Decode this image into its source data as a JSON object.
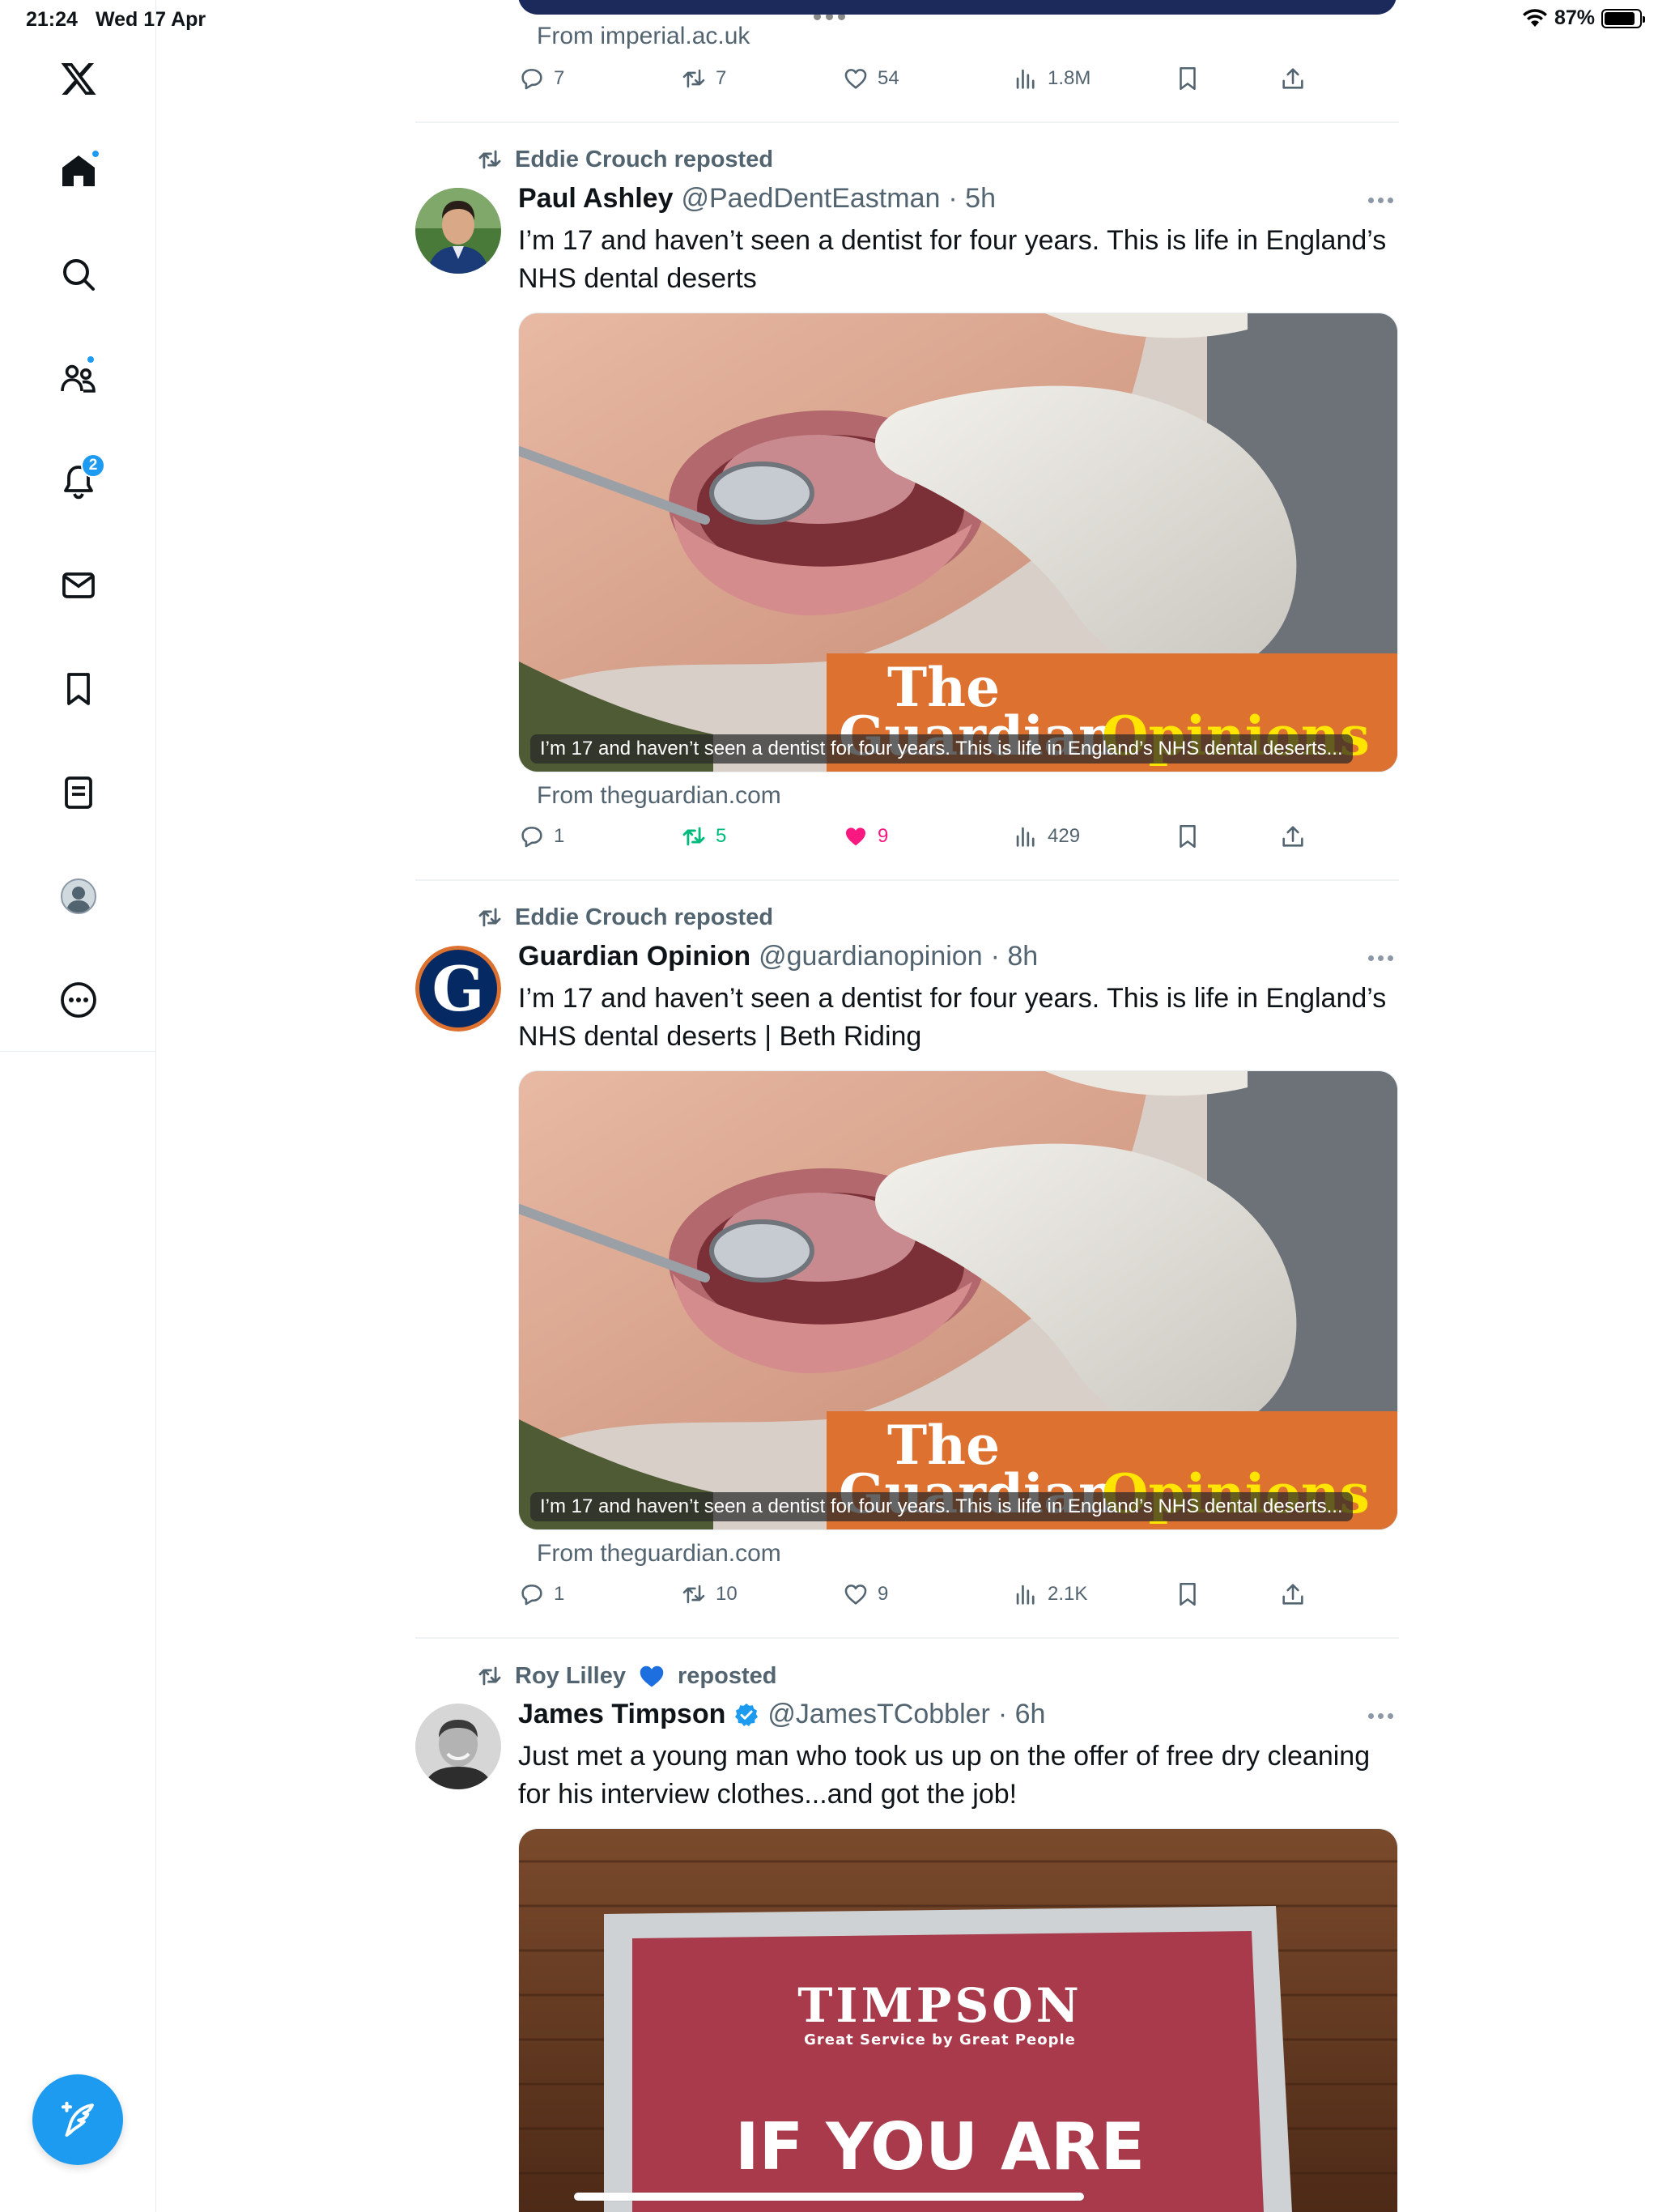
{
  "status_bar": {
    "time": "21:24",
    "date": "Wed 17 Apr",
    "battery": "87%",
    "battery_level": 0.87
  },
  "sidebar": {
    "items": [
      {
        "name": "x-logo"
      },
      {
        "name": "home"
      },
      {
        "name": "explore"
      },
      {
        "name": "communities"
      },
      {
        "name": "notifications",
        "badge": "2"
      },
      {
        "name": "messages"
      },
      {
        "name": "bookmarks"
      },
      {
        "name": "lists"
      },
      {
        "name": "profile"
      },
      {
        "name": "more"
      }
    ],
    "compose_icon": "compose-feather-icon",
    "accent_color": "#1d9bf0"
  },
  "feed": {
    "top_tweet": {
      "source": "From imperial.ac.uk",
      "replies": "7",
      "reposts": "7",
      "likes": "54",
      "views": "1.8M"
    },
    "tweets": [
      {
        "reposted_by": "Eddie Crouch reposted",
        "name": "Paul Ashley",
        "handle": "@PaedDentEastman",
        "time": "· 5h",
        "text": "I’m 17 and haven’t seen a dentist for four years. This is life in England’s NHS dental deserts",
        "card_brand_1": "The",
        "card_brand_2": "Guardian",
        "card_brand_3": "Opinions",
        "caption": "I’m 17 and haven’t seen a dentist for four years. This is life in England’s NHS dental deserts...",
        "source": "From theguardian.com",
        "replies": "1",
        "reposts": "5",
        "likes": "9",
        "views": "429",
        "liked": true,
        "reposted": true
      },
      {
        "reposted_by": "Eddie Crouch reposted",
        "name": "Guardian Opinion",
        "handle": "@guardianopinion",
        "time": "· 8h",
        "text": "I’m 17 and haven’t seen a dentist for four years. This is life in England’s NHS dental deserts | Beth Riding",
        "card_brand_1": "The",
        "card_brand_2": "Guardian",
        "card_brand_3": "Opinions",
        "caption": "I’m 17 and haven’t seen a dentist for four years. This is life in England’s NHS dental deserts...",
        "source": "From theguardian.com",
        "replies": "1",
        "reposts": "10",
        "likes": "9",
        "views": "2.1K",
        "avatar_letter": "G"
      },
      {
        "reposted_by_name": "Roy Lilley",
        "reposted_by_suffix": "reposted",
        "name": "James Timpson",
        "handle": "@JamesTCobbler",
        "time": "· 6h",
        "text": "Just met a young man who took us up on the offer of free dry cleaning for his interview clothes...and got the job!",
        "sign_brand": "TIMPSON",
        "sign_tagline": "Great Service by Great People",
        "sign_line": "IF YOU ARE"
      }
    ]
  },
  "colors": {
    "like_pink": "#f91880",
    "repost_green": "#00ba7c",
    "muted": "#536471",
    "guardian_orange": "#dd7130",
    "guardian_yellow": "#ffe500",
    "guardian_navy": "#052962"
  }
}
